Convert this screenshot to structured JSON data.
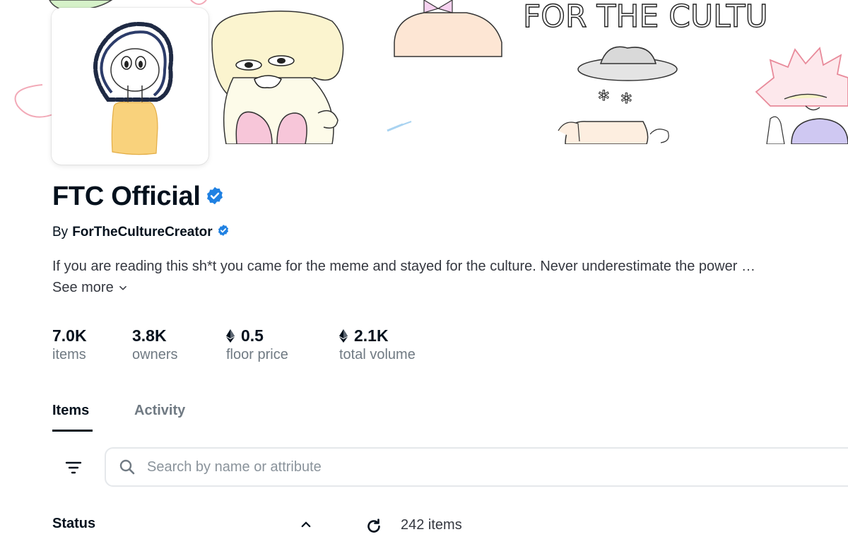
{
  "collection": {
    "title": "FTC Official",
    "by_label": "By",
    "creator": "ForTheCultureCreator",
    "description": "If you are reading this sh*t you came for the meme and stayed for the culture. Never underestimate the power …",
    "see_more": "See more"
  },
  "banner": {
    "art_text": "FOR THE CULTU"
  },
  "stats": [
    {
      "value": "7.0K",
      "label": "items",
      "eth": false
    },
    {
      "value": "3.8K",
      "label": "owners",
      "eth": false
    },
    {
      "value": "0.5",
      "label": "floor price",
      "eth": true
    },
    {
      "value": "2.1K",
      "label": "total volume",
      "eth": true
    }
  ],
  "tabs": [
    {
      "label": "Items",
      "active": true
    },
    {
      "label": "Activity",
      "active": false
    }
  ],
  "search": {
    "placeholder": "Search by name or attribute",
    "value": ""
  },
  "filters": {
    "status_label": "Status"
  },
  "results": {
    "count_text": "242 items"
  },
  "colors": {
    "verified": "#2081e2",
    "text_primary": "#04111d",
    "text_secondary": "#707a83",
    "border": "#e5e8eb"
  },
  "icons": {
    "verified": "verified-badge-icon",
    "eth": "ethereum-icon",
    "filter": "filter-list-icon",
    "search": "search-icon",
    "chevron_up": "chevron-up-icon",
    "chevron_down": "chevron-down-icon",
    "refresh": "refresh-icon"
  }
}
